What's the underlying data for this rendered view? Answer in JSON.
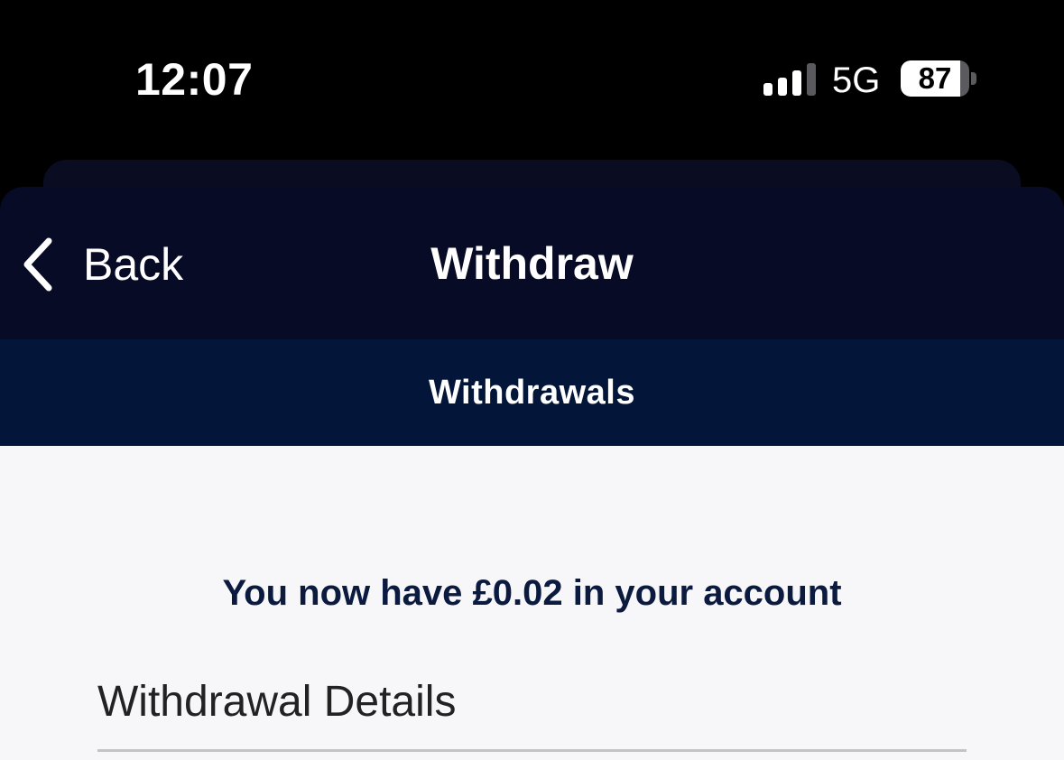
{
  "status_bar": {
    "time": "12:07",
    "network": "5G",
    "battery": "87",
    "battery_level": 0.87,
    "signal_bars_active": 3,
    "signal_bars_total": 4
  },
  "nav": {
    "back_label": "Back",
    "title": "Withdraw"
  },
  "tab": {
    "label": "Withdrawals"
  },
  "main": {
    "balance_text": "You now have £0.02 in your account",
    "section_title": "Withdrawal Details"
  },
  "colors": {
    "background": "#000000",
    "header": "#080b25",
    "tab_bar": "#04153a",
    "content": "#f7f7f9",
    "balance_text": "#0b1a3f"
  },
  "icons": {
    "back": "chevron-left-icon",
    "signal": "cellular-signal-icon",
    "battery": "battery-icon"
  }
}
